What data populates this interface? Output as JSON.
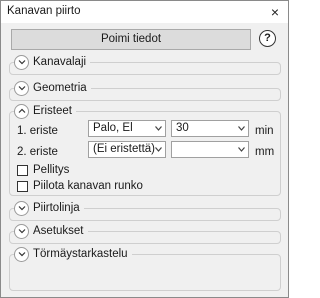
{
  "window": {
    "title": "Kanavan piirto",
    "close_glyph": "×"
  },
  "toolbar": {
    "pick_button": "Poimi tiedot",
    "help_glyph": "?"
  },
  "sections": {
    "kanavalaji": {
      "label": "Kanavalaji",
      "expanded": false
    },
    "geometria": {
      "label": "Geometria",
      "expanded": false
    },
    "eristeet": {
      "label": "Eristeet",
      "expanded": true,
      "row1": {
        "label": "1. eriste",
        "material": "Palo, El",
        "thickness": "30",
        "unit": "min"
      },
      "row2": {
        "label": "2. eriste",
        "material": "(Ei eristettä)",
        "thickness": "",
        "unit": "mm"
      },
      "pellitys": {
        "label": "Pellitys",
        "checked": false
      },
      "piilota": {
        "label": "Piilota kanavan runko",
        "checked": false
      }
    },
    "piirtolinja": {
      "label": "Piirtolinja",
      "expanded": false
    },
    "asetukset": {
      "label": "Asetukset",
      "expanded": false
    },
    "tormays": {
      "label": "Törmäystarkastelu",
      "expanded": false
    }
  },
  "icons": {
    "chevron_collapsed": "chevron-down-icon",
    "chevron_expanded": "chevron-up-icon",
    "dropdown": "dropdown-arrow-icon"
  }
}
